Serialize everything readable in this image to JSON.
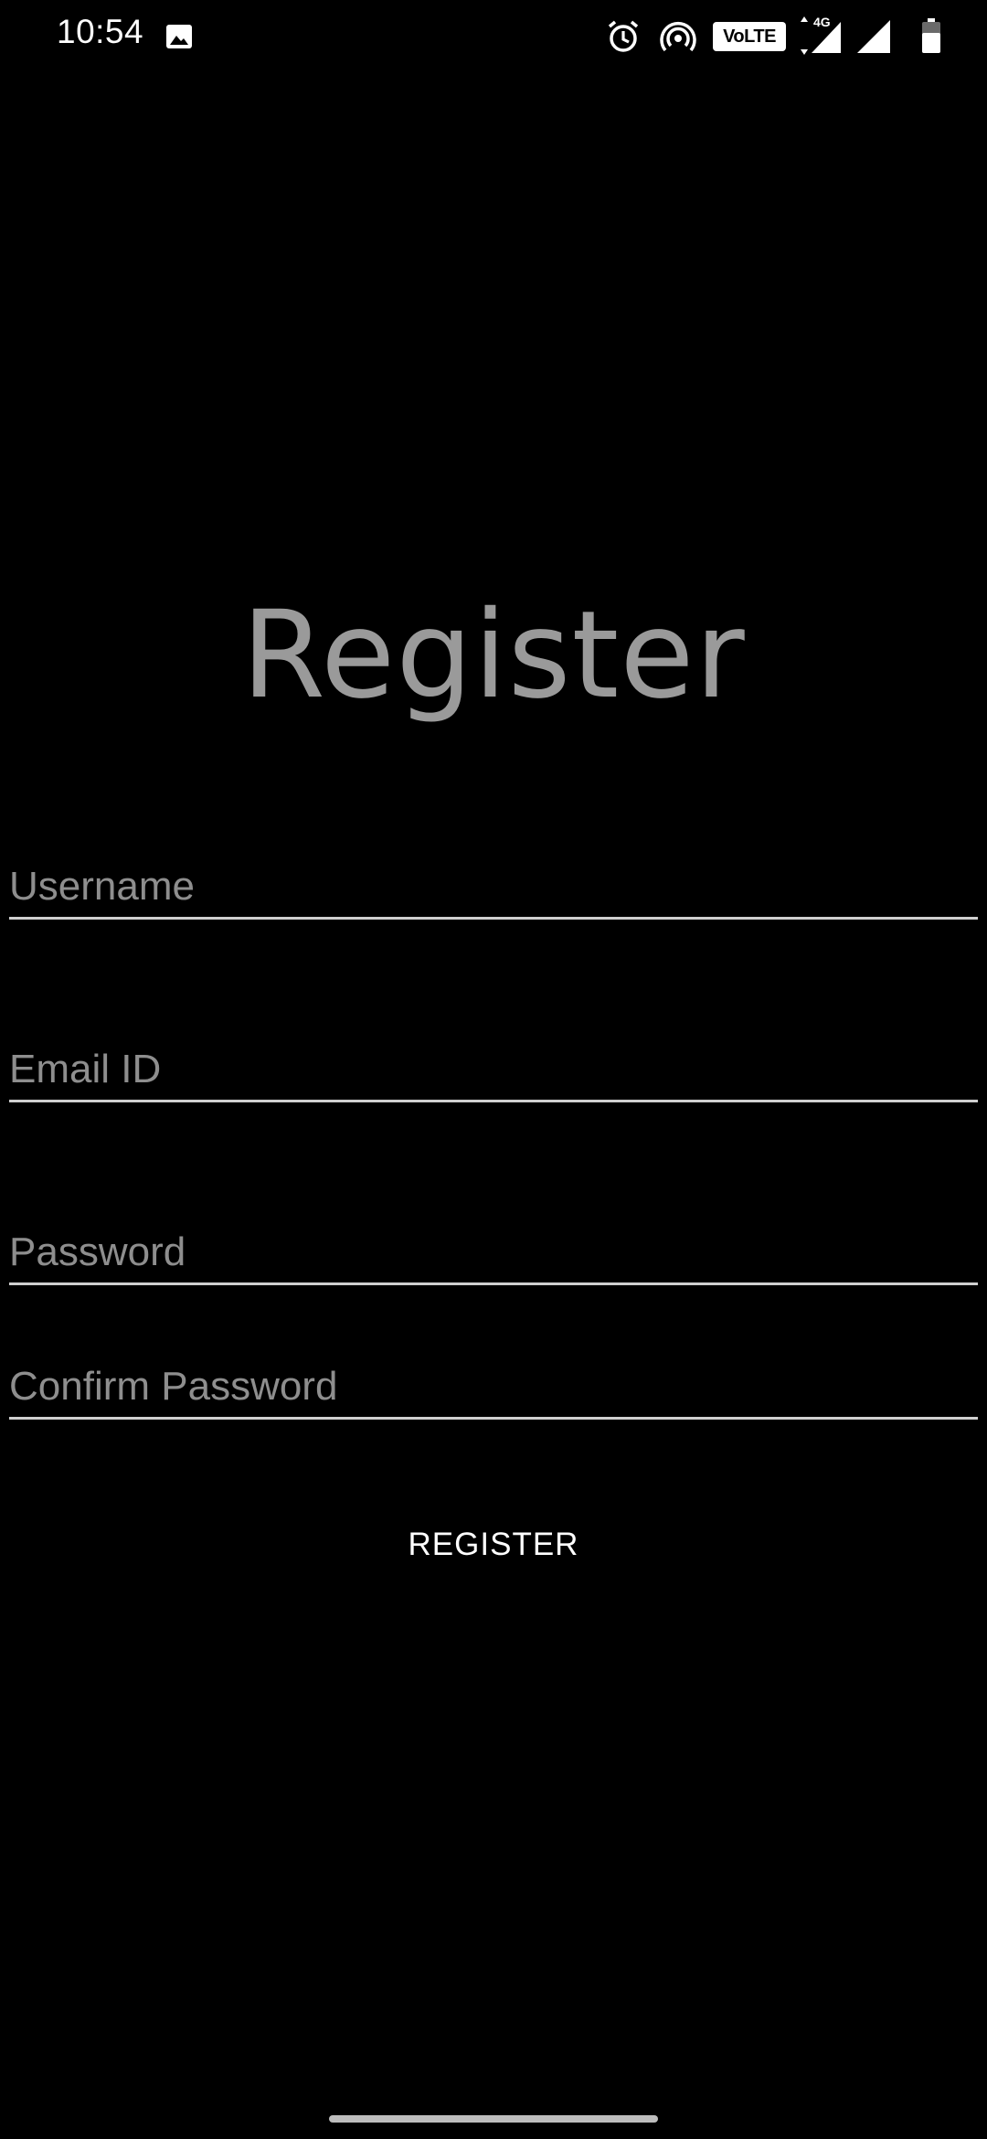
{
  "status_bar": {
    "time": "10:54",
    "volte_label": "VoLTE",
    "network_label": "4G",
    "icons": [
      "gallery-icon",
      "alarm-icon",
      "hotspot-icon",
      "signal-icon",
      "signal-icon",
      "battery-icon"
    ]
  },
  "page": {
    "title": "Register"
  },
  "form": {
    "username": {
      "placeholder": "Username",
      "value": ""
    },
    "email": {
      "placeholder": "Email ID",
      "value": ""
    },
    "password": {
      "placeholder": "Password",
      "value": ""
    },
    "confirm_password": {
      "placeholder": "Confirm Password",
      "value": ""
    },
    "submit_label": "REGISTER"
  },
  "colors": {
    "background": "#000000",
    "title": "#9a9a9a",
    "placeholder": "#8e8e8e",
    "underline": "#cfcfcf",
    "button_text": "#ffffff"
  }
}
